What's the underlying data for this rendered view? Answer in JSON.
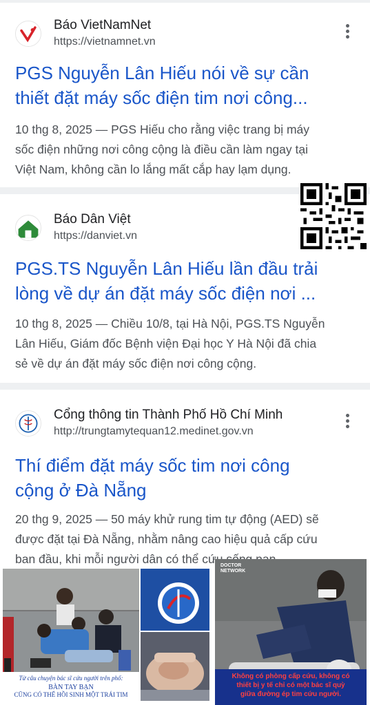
{
  "results": [
    {
      "site_name": "Báo VietNamNet",
      "url": "https://vietnamnet.vn",
      "title_line1": "PGS Nguyễn Lân Hiếu nói về sự cần",
      "title_line2": "thiết đặt máy sốc điện tim nơi công...",
      "snippet_line1": "10 thg 8, 2025 — PGS Hiếu cho rằng việc trang bị máy",
      "snippet_line2": "sốc điện những nơi công cộng là điều cần làm ngay tại",
      "snippet_line3": "Việt Nam, không cần lo lắng mất cắp hay lạm dụng."
    },
    {
      "site_name": "Báo Dân Việt",
      "url": "https://danviet.vn",
      "title_line1": "PGS.TS Nguyễn Lân Hiếu lần đầu trải",
      "title_line2": "lòng về dự án đặt máy sốc điện nơi ...",
      "snippet_line1": "10 thg 8, 2025 — Chiều 10/8, tại Hà Nội, PGS.TS Nguyễn",
      "snippet_line2": "Lân Hiếu, Giám đốc Bệnh viện Đại học Y Hà Nội đã chia",
      "snippet_line3": "sẻ về dự án đặt máy sốc điện nơi công cộng."
    },
    {
      "site_name": "Cổng thông tin Thành Phố Hồ Chí Minh",
      "url": "http://trungtamytequan12.medinet.gov.vn",
      "title_line1": "Thí điểm đặt máy sốc tim nơi công",
      "title_line2": "cộng ở Đà Nẵng",
      "snippet_line1": "20 thg 9, 2025 — 50 máy khử rung tim tự động (AED) sẽ",
      "snippet_line2": "được đặt tại Đà Nẵng, nhằm nâng cao hiệu quả cấp cứu",
      "snippet_line3": "ban đầu, khi mỗi người dân có thể cứu sống nạn ..."
    }
  ],
  "overlay": {
    "left_caption_line1": "Từ câu chuyện bác sĩ cứu người trên phố:",
    "left_caption_line2": "BÀN TAY BẠN",
    "left_caption_line3": "CŨNG CÓ THỂ HỒI SINH MỘT TRÁI TIM",
    "right_badge": "DOCTOR NETWORK",
    "right_caption_line1": "Không có phòng cấp cứu, không có",
    "right_caption_line2": "thiết bị y tế chỉ có một bác sĩ quỳ",
    "right_caption_line3": "giữa đường ép tim cứu người."
  },
  "icons": [
    "more-vert-icon",
    "vietnamnet-logo-icon",
    "danviet-logo-icon",
    "medinet-logo-icon",
    "qr-code"
  ],
  "colors": {
    "link_title": "#1a56c9",
    "snippet": "#4d5156",
    "separator": "#eef0f2",
    "caption_red": "#c41e1e",
    "caption_blue": "#1b3f9e"
  }
}
